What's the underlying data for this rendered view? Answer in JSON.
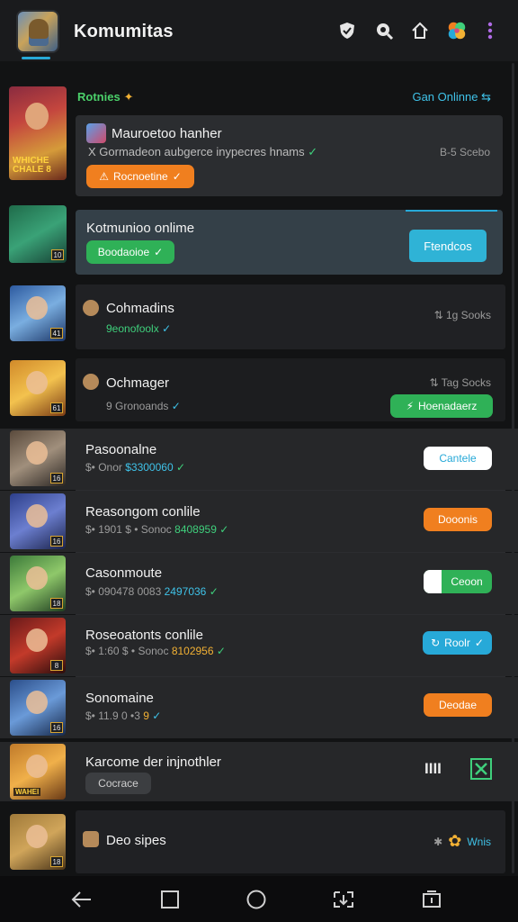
{
  "header": {
    "title": "Komumitas",
    "icons": [
      "shield-icon",
      "search-icon",
      "home-icon",
      "clover-icon",
      "more-icon"
    ]
  },
  "featured": {
    "section_title": "Rotnies",
    "section_link": "Gan Onlinne",
    "thumb_badge": "WHICHE CHALE 8",
    "card1": {
      "title": "Mauroetoo hanher",
      "subtitle": "X Gormadeon aubgerce inypecres hnams",
      "right_text": "B-5 Scebo",
      "pill_label": "Rocnoetine"
    },
    "card2": {
      "title": "Kotmunioo onlime",
      "pill_label": "Boodaoioe",
      "button_label": "Ftendcos"
    }
  },
  "rows": [
    {
      "title": "Cohmadins",
      "sub_a": "9eonofoolx",
      "right_text": "1g Sooks",
      "level": "41",
      "button": null
    },
    {
      "title": "Ochmager",
      "sub_a": "9 Gronoands",
      "right_text": "Tag Socks",
      "level": "61",
      "button": "Hoenadaerz"
    },
    {
      "title": "Pasoonalne",
      "sub_a": "$• Onor",
      "sub_b": "$3300060",
      "level": "16",
      "button": "Cantele"
    },
    {
      "title": "Reasongom conlile",
      "sub_a": "$• 1901 $ • Sonoc",
      "sub_b": "8408959",
      "level": "16",
      "button": "Dooonis"
    },
    {
      "title": "Casonmoute",
      "sub_a": "$• 090478 0083",
      "sub_b": "2497036",
      "level": "18",
      "button": "Ceoon"
    },
    {
      "title": "Roseoatonts conlile",
      "sub_a": "$• 1:60 $ • Sonoc",
      "sub_b": "8102956",
      "level": "8",
      "button": "Roolr"
    },
    {
      "title": "Sonomaine",
      "sub_a": "$• 11.9 0 •3",
      "sub_b": "9",
      "level": "16",
      "button": "Deodae"
    },
    {
      "title": "Karcome der injnothler",
      "sub_a": "Cocrace",
      "badge_text": "WAHEI",
      "button": "IIII"
    },
    {
      "title": "Deo sipes",
      "right_text": "Wnis",
      "level": "18"
    }
  ],
  "nav": [
    "back-icon",
    "square-icon",
    "home-circle-icon",
    "screenshot-icon",
    "switch-icon"
  ],
  "colors": {
    "accent_teal": "#27a9d8",
    "accent_green": "#2fb157",
    "accent_orange": "#f07f1f",
    "bg": "#121314"
  }
}
